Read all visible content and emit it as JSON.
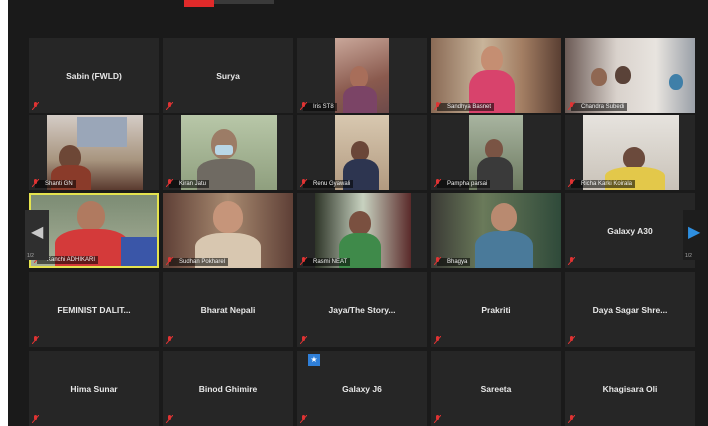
{
  "participants": [
    {
      "name": "Sabin (FWLD)",
      "video": false
    },
    {
      "name": "Surya",
      "video": false
    },
    {
      "name": "Iris ST8",
      "video": true
    },
    {
      "name": "Sandhya Basnet",
      "video": true
    },
    {
      "name": "Chandra Subedi",
      "video": true
    },
    {
      "name": "Shanti GN",
      "video": true
    },
    {
      "name": "Kiran Jatu",
      "video": true
    },
    {
      "name": "Renu Gyawali",
      "video": true
    },
    {
      "name": "Pampha parsai",
      "video": true
    },
    {
      "name": "Richa Karki Koirala",
      "video": true
    },
    {
      "name": "Kanchi ADHIKARI",
      "video": true
    },
    {
      "name": "Sudhan Pokharel",
      "video": true
    },
    {
      "name": "Rasmi NEAT",
      "video": true
    },
    {
      "name": "Bhagya",
      "video": true
    },
    {
      "name": "Galaxy A30",
      "video": false
    },
    {
      "name": "FEMINIST DALIT...",
      "video": false
    },
    {
      "name": "Bharat Nepali",
      "video": false
    },
    {
      "name": "Jaya/The Story...",
      "video": false
    },
    {
      "name": "Prakriti",
      "video": false
    },
    {
      "name": "Daya Sagar Shre...",
      "video": false
    },
    {
      "name": "Hima Sunar",
      "video": false
    },
    {
      "name": "Binod Ghimire",
      "video": false
    },
    {
      "name": "Galaxy J6",
      "video": false
    },
    {
      "name": "Sareeta",
      "video": false
    },
    {
      "name": "Khagisara Oli",
      "video": false
    }
  ],
  "pagination": {
    "left": "1/2",
    "right": "1/2"
  },
  "colors": {
    "tile_bg": "#262626",
    "active_border": "#e5e34e",
    "mute_icon": "#e03333",
    "nav_arrow": "#2e8fe0"
  }
}
